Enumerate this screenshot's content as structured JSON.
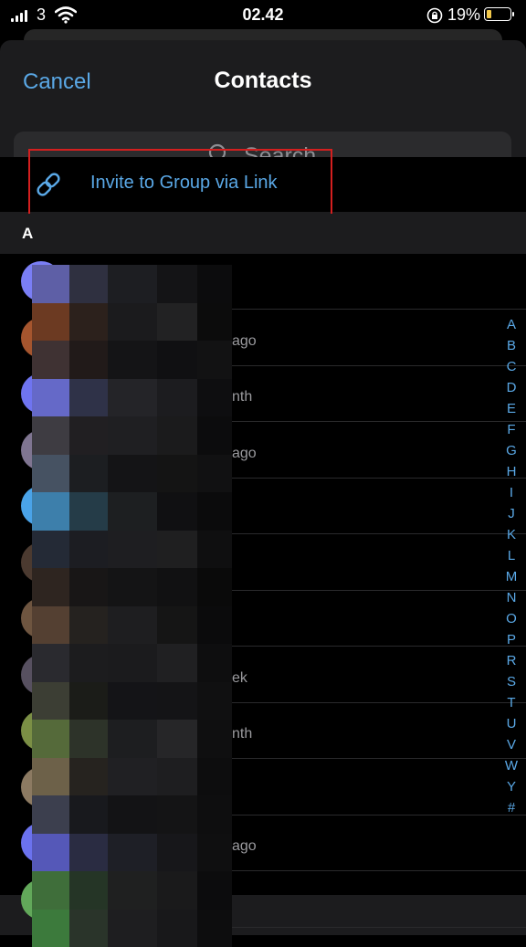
{
  "status_bar": {
    "carrier": "3",
    "time": "02.42",
    "battery": "19%",
    "battery_level": 0.19
  },
  "nav": {
    "cancel_label": "Cancel",
    "title": "Contacts"
  },
  "search": {
    "placeholder": "Search"
  },
  "invite": {
    "label": "Invite to Group via Link"
  },
  "section": {
    "letter": "A"
  },
  "contacts": [
    {
      "subtitle": "",
      "avatar_color": "#7a7ef5"
    },
    {
      "subtitle": "ago",
      "avatar_color": "#a5552e"
    },
    {
      "subtitle": "nth",
      "avatar_color": "#6f74f0"
    },
    {
      "subtitle": "ago",
      "avatar_color": "#7f7591"
    },
    {
      "subtitle": "",
      "avatar_color": "#4aa3e8"
    },
    {
      "subtitle": "",
      "avatar_color": "#4b3a30"
    },
    {
      "subtitle": "",
      "avatar_color": "#6e5540"
    },
    {
      "subtitle": "ek",
      "avatar_color": "#575060"
    },
    {
      "subtitle": "nth",
      "avatar_color": "#7b8f45"
    },
    {
      "subtitle": "",
      "avatar_color": "#8c7a62"
    },
    {
      "subtitle": "ago",
      "avatar_color": "#6b72ee"
    },
    {
      "subtitle": "",
      "avatar_color": "#62a85a"
    }
  ],
  "index_letters": [
    "A",
    "B",
    "C",
    "D",
    "E",
    "F",
    "G",
    "H",
    "I",
    "J",
    "K",
    "L",
    "M",
    "N",
    "O",
    "P",
    "R",
    "S",
    "T",
    "U",
    "V",
    "W",
    "Y",
    "#"
  ],
  "colors": {
    "accent": "#5aa8e6",
    "highlight_border": "#d41f1f",
    "background": "#000000",
    "sheet": "#1c1c1e"
  },
  "icons": {
    "search": "magnifying-glass-icon",
    "invite": "link-icon",
    "wifi": "wifi-icon",
    "lock": "orientation-lock-icon"
  },
  "pixelation": [
    [
      "#5e5fa6",
      "#2f3040",
      "#1d1e22",
      "#141416",
      "#0c0c0d"
    ],
    [
      "#6c3a22",
      "#2c211c",
      "#1b1b1d",
      "#222223",
      "#0c0c0c"
    ],
    [
      "#3f3233",
      "#211a19",
      "#141416",
      "#101012",
      "#121213"
    ],
    [
      "#6569c8",
      "#2f3248",
      "#242428",
      "#1c1c1f",
      "#0e0e10"
    ],
    [
      "#3e3c42",
      "#211f22",
      "#1f1f22",
      "#1b1b1c",
      "#0c0c0d"
    ],
    [
      "#465262",
      "#1c1e21",
      "#141416",
      "#141414",
      "#111112"
    ],
    [
      "#3d7fab",
      "#253c48",
      "#1d1f21",
      "#101012",
      "#0b0b0c"
    ],
    [
      "#242a36",
      "#1c1d22",
      "#1e1e21",
      "#1f1f20",
      "#0f0f10"
    ],
    [
      "#2e2520",
      "#181616",
      "#141415",
      "#111112",
      "#0a0a0a"
    ],
    [
      "#544032",
      "#25221f",
      "#1e1e20",
      "#151515",
      "#0b0b0c"
    ],
    [
      "#2a2a2f",
      "#1c1c1e",
      "#1b1b1d",
      "#202022",
      "#0e0e0f"
    ],
    [
      "#3c3e34",
      "#1b1c18",
      "#141417",
      "#141416",
      "#101011"
    ],
    [
      "#556a3a",
      "#2d3329",
      "#1d1e20",
      "#262628",
      "#0f0f10"
    ],
    [
      "#6d6149",
      "#26231f",
      "#202023",
      "#1e1e20",
      "#0d0d0e"
    ],
    [
      "#3c3f4e",
      "#18191d",
      "#131315",
      "#141415",
      "#0e0e0f"
    ],
    [
      "#5558b8",
      "#2a2c42",
      "#1e1f26",
      "#17171a",
      "#0f0f10"
    ],
    [
      "#3f6e3a",
      "#253526",
      "#1f2020",
      "#1a1a1b",
      "#0c0c0d"
    ],
    [
      "#3c7a3c",
      "#2a342a",
      "#1e1e20",
      "#18181a",
      "#0d0d0e"
    ]
  ]
}
